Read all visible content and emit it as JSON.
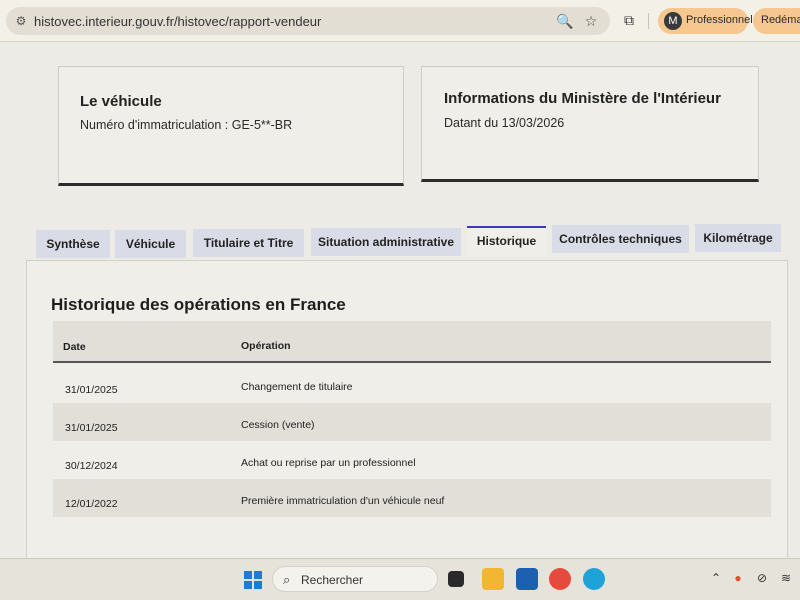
{
  "browser": {
    "url": "histovec.interieur.gouv.fr/histovec/rapport-vendeur",
    "profile_initial": "M",
    "profile_label": "Professionnel",
    "restart_label": "Redémarr"
  },
  "cards": {
    "vehicle": {
      "title": "Le véhicule",
      "subtitle": "Numéro d'immatriculation : GE-5**-BR"
    },
    "ministry": {
      "title": "Informations du Ministère de l'Intérieur",
      "subtitle": "Datant du 13/03/2026"
    }
  },
  "tabs": [
    {
      "label": "Synthèse",
      "active": false
    },
    {
      "label": "Véhicule",
      "active": false
    },
    {
      "label": "Titulaire et Titre",
      "active": false
    },
    {
      "label": "Situation administrative",
      "active": false
    },
    {
      "label": "Historique",
      "active": true
    },
    {
      "label": "Contrôles techniques",
      "active": false
    },
    {
      "label": "Kilométrage",
      "active": false
    }
  ],
  "history": {
    "title": "Historique des opérations en France",
    "columns": [
      "Date",
      "Opération"
    ],
    "rows": [
      {
        "date": "31/01/2025",
        "operation": "Changement de titulaire"
      },
      {
        "date": "31/01/2025",
        "operation": "Cession (vente)"
      },
      {
        "date": "30/12/2024",
        "operation": "Achat ou reprise par un professionnel"
      },
      {
        "date": "12/01/2022",
        "operation": "Première immatriculation d'un véhicule neuf"
      }
    ]
  },
  "taskbar": {
    "search_label": "Rechercher"
  }
}
